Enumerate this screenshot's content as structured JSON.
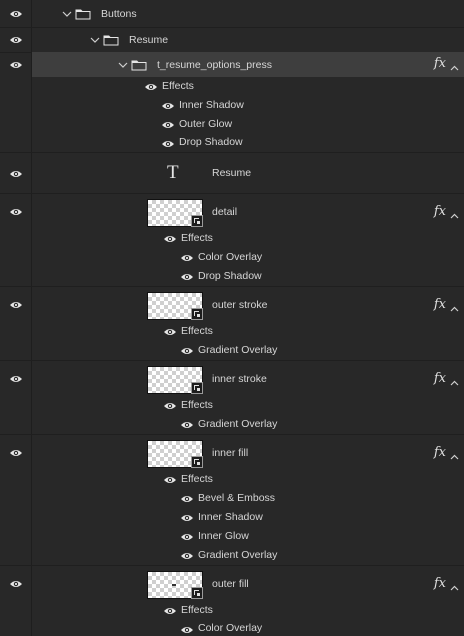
{
  "layers": {
    "buttons_group": {
      "name": "Buttons"
    },
    "resume_group": {
      "name": "Resume"
    },
    "options_group": {
      "name": "t_resume_options_press",
      "fx": "fx",
      "effects_label": "Effects",
      "effects": [
        "Inner Shadow",
        "Outer Glow",
        "Drop Shadow"
      ]
    },
    "text_layer": {
      "glyph": "T",
      "name": "Resume"
    },
    "detail": {
      "name": "detail",
      "fx": "fx",
      "effects_label": "Effects",
      "effects": [
        "Color Overlay",
        "Drop Shadow"
      ]
    },
    "outer_stroke": {
      "name": "outer stroke",
      "fx": "fx",
      "effects_label": "Effects",
      "effects": [
        "Gradient Overlay"
      ]
    },
    "inner_stroke": {
      "name": "inner stroke",
      "fx": "fx",
      "effects_label": "Effects",
      "effects": [
        "Gradient Overlay"
      ]
    },
    "inner_fill": {
      "name": "inner fill",
      "fx": "fx",
      "effects_label": "Effects",
      "effects": [
        "Bevel & Emboss",
        "Inner Shadow",
        "Inner Glow",
        "Gradient Overlay"
      ]
    },
    "outer_fill": {
      "name": "outer fill",
      "fx": "fx",
      "effects_label": "Effects",
      "effects": [
        "Color Overlay"
      ]
    }
  },
  "icons": {
    "visibility": "eye-icon",
    "expand": "chevron-down-icon",
    "folder": "folder-icon",
    "text_layer": "text-layer-icon",
    "smart_object": "smart-object-icon",
    "fx": "fx-icon",
    "collapse": "chevron-up-icon"
  },
  "colors": {
    "panel_bg": "#282828",
    "selected_row_bg": "#3e3e3e",
    "text": "#d6d6d6",
    "separator": "#1f1f1f"
  }
}
